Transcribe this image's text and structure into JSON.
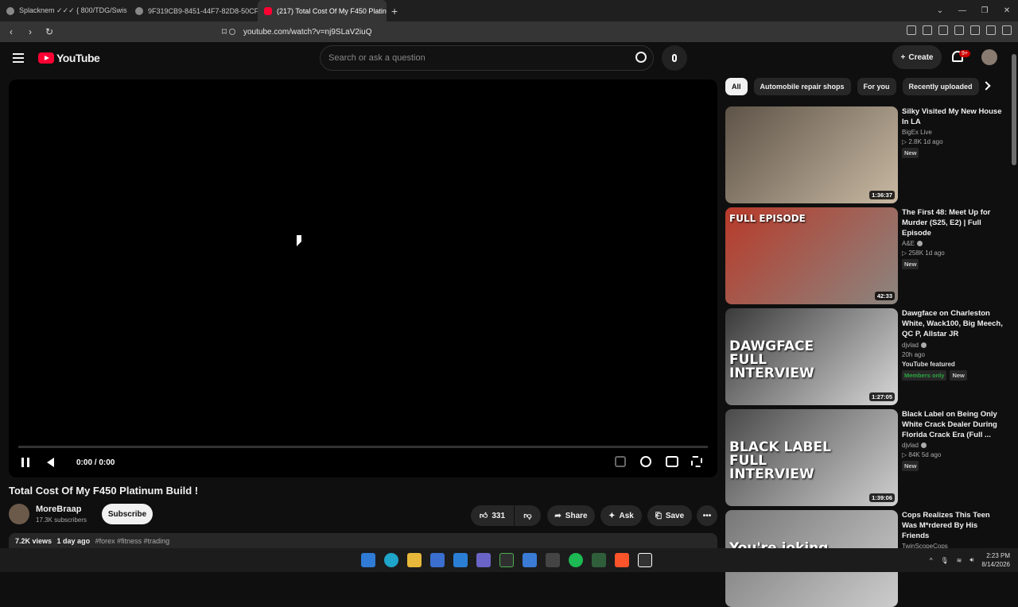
{
  "browser": {
    "tabs": [
      {
        "label": "Splacknem ✓✓✓ { 800/TDG/Swis",
        "active": false
      },
      {
        "label": "9F319CB9-8451-44F7-82D8-50CF03",
        "active": false
      },
      {
        "label": "(217) Total Cost Of My F450 Platin",
        "active": true
      }
    ],
    "new_tab_glyph": "+",
    "url": "youtube.com/watch?v=nj9SLaV2iuQ"
  },
  "header": {
    "logo_text": "YouTube",
    "search_placeholder": "Search or ask a question",
    "create_label": "Create",
    "notification_count": "9+"
  },
  "player": {
    "time": "0:00 / 0:00"
  },
  "video": {
    "title": "Total Cost Of My F450 Platinum Build !",
    "channel": "MoreBraap",
    "subscribers": "17.3K subscribers",
    "subscribe_label": "Subscribe",
    "likes": "331",
    "share_label": "Share",
    "ask_label": "Ask",
    "save_label": "Save",
    "views": "7.2K views",
    "age": "1 day ago",
    "tags": "#forex #fitness #trading"
  },
  "chips": [
    "All",
    "Automobile repair shops",
    "For you",
    "Recently uploaded"
  ],
  "recommendations": [
    {
      "title": "Silky Visited My New House In LA",
      "channel": "BigEx Live",
      "verified": false,
      "stats": "▷ 2.8K  1d ago",
      "duration": "1:36:37",
      "badges": [
        "New"
      ],
      "thumb_caption": "",
      "colors": [
        "#5d5347",
        "#c9b9a3"
      ]
    },
    {
      "title": "The First 48: Meet Up for Murder (S25, E2) | Full Episode",
      "channel": "A&E",
      "verified": true,
      "stats": "▷ 258K  1d ago",
      "duration": "42:33",
      "badges": [
        "New"
      ],
      "thumb_caption": "FULL EPISODE",
      "colors": [
        "#b83a2a",
        "#8b8680"
      ]
    },
    {
      "title": "Dawgface on Charleston White, Wack100, Big Meech, QC P, Allstar JR (Uncensore...",
      "channel": "djvlad",
      "verified": true,
      "stats": "20h ago",
      "duration": "1:27:05",
      "featured": "YouTube featured",
      "badges": [
        "Members only",
        "New"
      ],
      "thumb_caption": "DAWGFACE FULL INTERVIEW",
      "colors": [
        "#3a3a3a",
        "#d8d8d8"
      ]
    },
    {
      "title": "Black Label on Being Only White Crack Dealer During Florida Crack Era (Full ...",
      "channel": "djvlad",
      "verified": true,
      "stats": "▷ 84K  5d ago",
      "duration": "1:39:06",
      "badges": [
        "New"
      ],
      "thumb_caption": "BLACK LABEL FULL INTERVIEW",
      "colors": [
        "#4a4a4a",
        "#cfcfcf"
      ]
    },
    {
      "title": "Cops Realizes This Teen Was M*rdered By His Friends",
      "channel": "TwinScopeCops",
      "verified": false,
      "stats": "",
      "duration": "",
      "badges": [],
      "thumb_caption": "You're joking right?",
      "colors": [
        "#777",
        "#ccc"
      ]
    }
  ],
  "taskbar": {
    "time": "2:23 PM",
    "date": "8/14/2026"
  },
  "colors": {
    "accent": "#ff0033",
    "background": "#0f0f0f",
    "surface": "#272727"
  }
}
